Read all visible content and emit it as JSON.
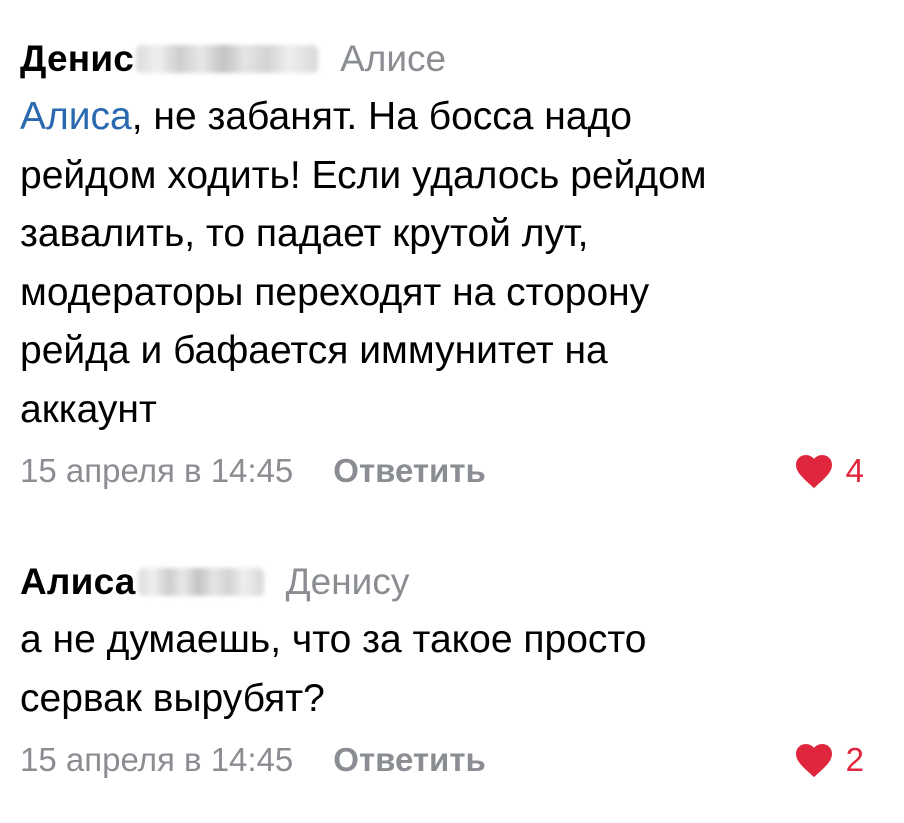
{
  "comments": [
    {
      "author": "Денис",
      "reply_to": "Алисе",
      "mention": "Алиса",
      "text_lines": [
        ", не забанят. На босса надо",
        "рейдом ходить! Если удалось рейдом",
        "завалить, то падает крутой лут,",
        "модераторы переходят на сторону",
        "рейда и бафается иммунитет на",
        "аккаунт"
      ],
      "timestamp": "15 апреля в 14:45",
      "reply_label": "Ответить",
      "likes": "4"
    },
    {
      "author": "Алиса",
      "reply_to": "Денису",
      "text_lines": [
        "а не думаешь, что за такое просто",
        "сервак вырубят?"
      ],
      "timestamp": "15 апреля в 14:45",
      "reply_label": "Ответить",
      "likes": "2"
    }
  ],
  "icons": {
    "like": "heart-icon"
  },
  "colors": {
    "mention": "#2a69b0",
    "secondary_text": "#8a8d91",
    "like": "#e0263c"
  }
}
